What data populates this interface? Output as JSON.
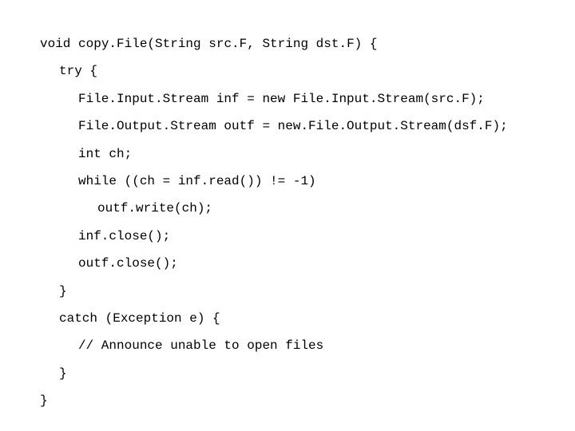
{
  "code": {
    "line1": "void copy.File(String src.F, String dst.F) {",
    "line2": "try {",
    "line3": "File.Input.Stream inf = new File.Input.Stream(src.F);",
    "line4": "File.Output.Stream outf = new.File.Output.Stream(dsf.F);",
    "line5": "int ch;",
    "line6": "while ((ch = inf.read()) != -1)",
    "line7": "outf.write(ch);",
    "line8": "inf.close();",
    "line9": "outf.close();",
    "line10": "}",
    "line11": "catch (Exception e) {",
    "line12": "// Announce unable to open files",
    "line13": "}",
    "line14": "}"
  }
}
